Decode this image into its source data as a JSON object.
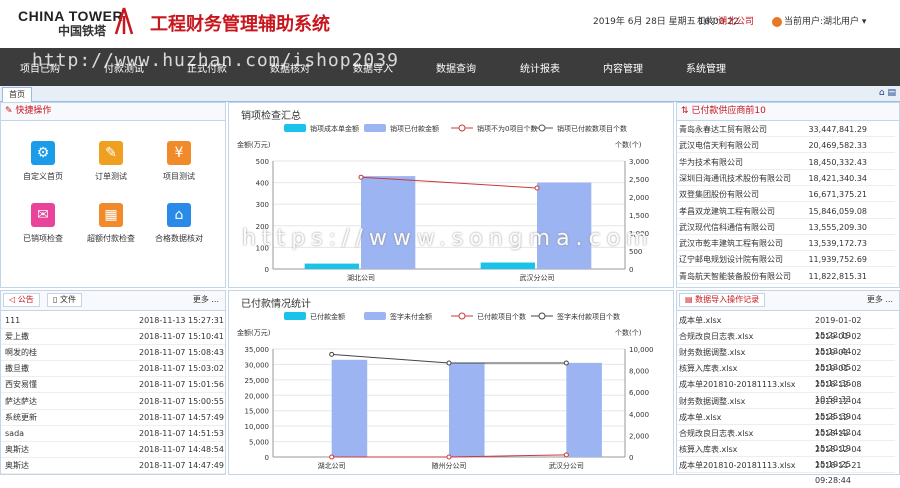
{
  "header": {
    "logo_en": "CHINA TOWER",
    "logo_cn": "中国铁塔",
    "title": "工程财务管理辅助系统",
    "datetime": "2019年 6月 28日 星期五 16:00:22",
    "org_label": "机构:",
    "org_value": "湖北公司",
    "user_label": "当前用户:",
    "user_value": "湖北用户"
  },
  "nav": [
    "项目已购",
    "付款测试",
    "正式付款",
    "数据核对",
    "数据导入",
    "数据查询",
    "统计报表",
    "内容管理",
    "系统管理"
  ],
  "tabs": {
    "home": "首页"
  },
  "quick": {
    "title": "快捷操作",
    "items": [
      {
        "label": "自定义首页",
        "color": "#1a9ce8",
        "icon": "⚙"
      },
      {
        "label": "订单测试",
        "color": "#f0a020",
        "icon": "✎"
      },
      {
        "label": "项目测试",
        "color": "#f08a2a",
        "icon": "¥"
      },
      {
        "label": "已销项检查",
        "color": "#e8459a",
        "icon": "✉"
      },
      {
        "label": "超额付款检查",
        "color": "#f08a2a",
        "icon": "▦"
      },
      {
        "label": "合格数据核对",
        "color": "#2a8ae8",
        "icon": "⌂"
      }
    ]
  },
  "chart1": {
    "title": "销项检查汇总",
    "legend": [
      "销项成本单金额",
      "销项已付款金额",
      "销项不为0项目个数",
      "销项已付款数项目个数"
    ]
  },
  "chart2": {
    "title": "已付款情况统计",
    "legend": [
      "已付款金额",
      "签字未付金额",
      "已付款项目个数",
      "签字未付款项目个数"
    ]
  },
  "chart_data": [
    {
      "type": "bar",
      "title": "销项检查汇总",
      "categories": [
        "湖北公司",
        "武汉分公司"
      ],
      "ylabel": "金额(万元)",
      "y2label": "个数(个)",
      "ylim": [
        0,
        500
      ],
      "y2lim": [
        0,
        3000
      ],
      "yticks": [
        "0",
        "100",
        "200",
        "300",
        "400",
        "500"
      ],
      "y2ticks": [
        "0",
        "500",
        "1,000",
        "1,500",
        "2,000",
        "2,500",
        "3,000"
      ],
      "series": [
        {
          "name": "销项成本单金额",
          "kind": "bar",
          "color": "#19c3ea",
          "values": [
            25,
            30
          ]
        },
        {
          "name": "销项已付款金额",
          "kind": "bar",
          "color": "#9db4f2",
          "values": [
            430,
            400
          ]
        },
        {
          "name": "销项不为0项目个数",
          "kind": "line",
          "color": "#c9393b",
          "axis": "right",
          "values": [
            2550,
            2250
          ]
        },
        {
          "name": "销项已付款数项目个数",
          "kind": "line",
          "color": "#555555",
          "axis": "right",
          "values": [
            null,
            null
          ]
        }
      ]
    },
    {
      "type": "bar",
      "title": "已付款情况统计",
      "categories": [
        "湖北公司",
        "随州分公司",
        "武汉分公司"
      ],
      "ylabel": "金额(万元)",
      "y2label": "个数(个)",
      "ylim": [
        0,
        35000
      ],
      "y2lim": [
        0,
        10000
      ],
      "yticks": [
        "0",
        "5,000",
        "10,000",
        "15,000",
        "20,000",
        "25,000",
        "30,000",
        "35,000"
      ],
      "y2ticks": [
        "0",
        "2,000",
        "4,000",
        "6,000",
        "8,000",
        "10,000"
      ],
      "series": [
        {
          "name": "已付款金额",
          "kind": "bar",
          "color": "#19c3ea",
          "values": [
            0,
            0,
            0
          ]
        },
        {
          "name": "签字未付金额",
          "kind": "bar",
          "color": "#9db4f2",
          "values": [
            31500,
            30500,
            30500
          ]
        },
        {
          "name": "已付款项目个数",
          "kind": "line",
          "color": "#c9393b",
          "axis": "right",
          "values": [
            0,
            0,
            200
          ]
        },
        {
          "name": "签字未付款项目个数",
          "kind": "line",
          "color": "#444444",
          "axis": "right",
          "values": [
            9500,
            8700,
            8700
          ]
        }
      ]
    }
  ],
  "notice": {
    "tab1": "公告",
    "tab2": "文件",
    "more": "更多 ...",
    "rows": [
      {
        "t": "111",
        "d": "2018-11-13 15:27:31"
      },
      {
        "t": "爱上撒",
        "d": "2018-11-07 15:10:41"
      },
      {
        "t": "啊发的桂",
        "d": "2018-11-07 15:08:43"
      },
      {
        "t": "撒旦撒",
        "d": "2018-11-07 15:03:02"
      },
      {
        "t": "西安易懂",
        "d": "2018-11-07 15:01:56"
      },
      {
        "t": "萨达萨达",
        "d": "2018-11-07 15:00:55"
      },
      {
        "t": "系统更新",
        "d": "2018-11-07 14:57:49"
      },
      {
        "t": "sada",
        "d": "2018-11-07 14:51:53"
      },
      {
        "t": "奥斯达",
        "d": "2018-11-07 14:48:54"
      },
      {
        "t": "奥斯达",
        "d": "2018-11-07 14:47:49"
      }
    ]
  },
  "ranking": {
    "title": "已付款供应商前10",
    "rows": [
      {
        "n": "青岛永春达工贸有限公司",
        "v": "33,447,841.29"
      },
      {
        "n": "武汉电信天利有限公司",
        "v": "20,469,582.33"
      },
      {
        "n": "华为技术有限公司",
        "v": "18,450,332.43"
      },
      {
        "n": "深圳日海通讯技术股份有限公司",
        "v": "18,421,340.34"
      },
      {
        "n": "双登集团股份有限公司",
        "v": "16,671,375.21"
      },
      {
        "n": "孝昌双龙建筑工程有限公司",
        "v": "15,846,059.08"
      },
      {
        "n": "武汉现代信科通信有限公司",
        "v": "13,555,209.30"
      },
      {
        "n": "武汉市乾丰建筑工程有限公司",
        "v": "13,539,172.73"
      },
      {
        "n": "辽宁邮电规划设计院有限公司",
        "v": "11,939,752.69"
      },
      {
        "n": "青岛航天智能装备股份有限公司",
        "v": "11,822,815.31"
      }
    ]
  },
  "imports": {
    "title": "数据导入操作记录",
    "more": "更多 ...",
    "rows": [
      {
        "n": "成本单.xlsx",
        "d": "2019-01-02 15:22:19"
      },
      {
        "n": "合规改良日志表.xlsx",
        "d": "2019-01-02 15:13:44"
      },
      {
        "n": "财务数据调整.xlsx",
        "d": "2019-01-02 15:13:05"
      },
      {
        "n": "核算入库表.xlsx",
        "d": "2019-01-02 15:12:36"
      },
      {
        "n": "成本单201810-20181113.xlsx",
        "d": "2018-12-08 10:59:33"
      },
      {
        "n": "财务数据调整.xlsx",
        "d": "2018-12-04 15:25:39"
      },
      {
        "n": "成本单.xlsx",
        "d": "2018-12-04 15:24:42"
      },
      {
        "n": "合规改良日志表.xlsx",
        "d": "2018-12-04 15:20:19"
      },
      {
        "n": "核算入库表.xlsx",
        "d": "2018-12-04 15:19:25"
      },
      {
        "n": "成本单201810-20181113.xlsx",
        "d": "2018-11-21 09:28:44"
      }
    ]
  },
  "watermarks": {
    "top": "http://www.huzhan.com/ishop2039",
    "mid": "https://www.songma.com"
  }
}
